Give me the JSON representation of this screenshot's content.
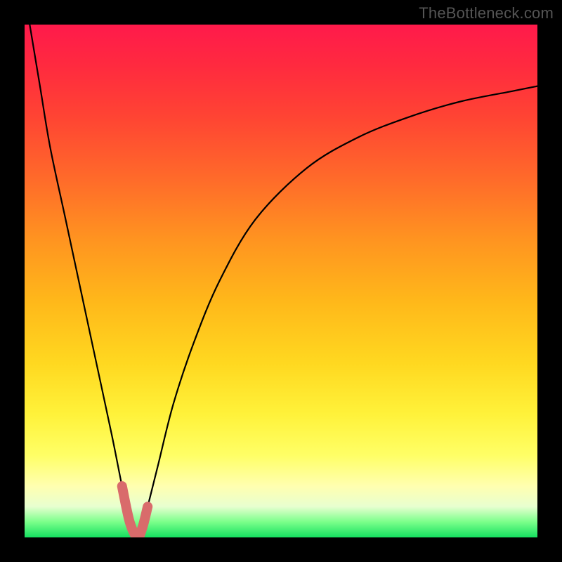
{
  "watermark": "TheBottleneck.com",
  "chart_data": {
    "type": "line",
    "title": "",
    "xlabel": "",
    "ylabel": "",
    "xlim": [
      0,
      100
    ],
    "ylim": [
      0,
      100
    ],
    "series": [
      {
        "name": "bottleneck-curve",
        "x": [
          1,
          3,
          5,
          8,
          11,
          14,
          17,
          19,
          20.5,
          22,
          23,
          24,
          26,
          29,
          33,
          38,
          45,
          55,
          65,
          75,
          85,
          95,
          100
        ],
        "values": [
          100,
          88,
          76,
          62,
          48,
          34,
          20,
          10,
          3,
          0,
          2,
          6,
          14,
          26,
          38,
          50,
          62,
          72,
          78,
          82,
          85,
          87,
          88
        ]
      }
    ],
    "marker_band": {
      "x_range": [
        19,
        25
      ],
      "y_range": [
        0,
        10
      ],
      "color": "#d96b6b"
    },
    "gradient_stops": [
      {
        "pos": 0.0,
        "color": "#ff1a4b"
      },
      {
        "pos": 0.3,
        "color": "#ff6a2a"
      },
      {
        "pos": 0.6,
        "color": "#ffd820"
      },
      {
        "pos": 0.85,
        "color": "#ffff90"
      },
      {
        "pos": 1.0,
        "color": "#15e060"
      }
    ]
  }
}
